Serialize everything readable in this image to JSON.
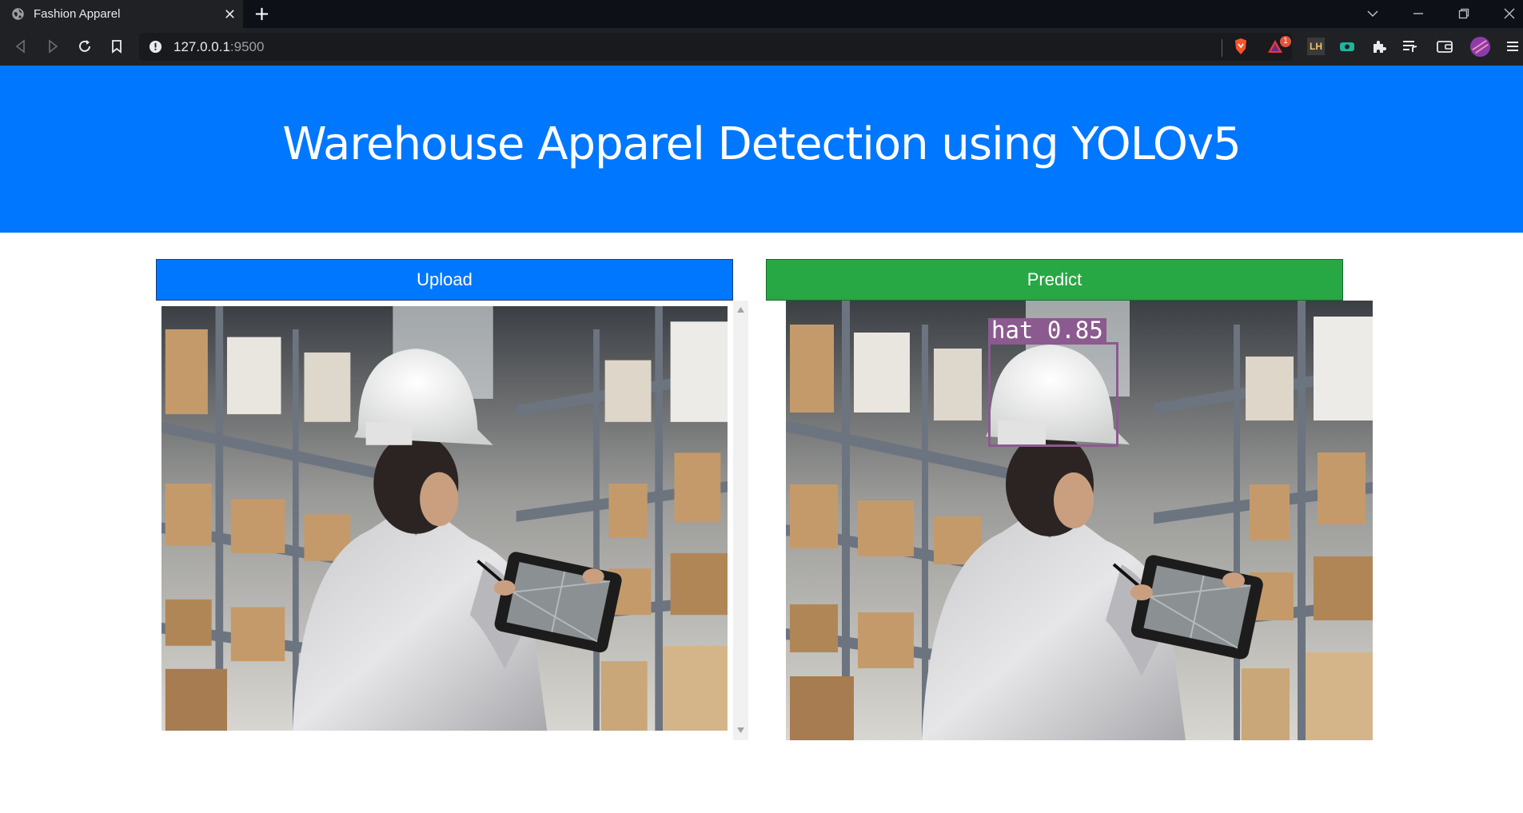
{
  "browser": {
    "tab_title": "Fashion Apparel",
    "url_host": "127.0.0.1",
    "url_port": ":9500",
    "notification_count": "1",
    "ext_lh_label": "LH"
  },
  "page": {
    "title": "Warehouse Apparel Detection using YOLOv5",
    "upload_label": "Upload",
    "predict_label": "Predict"
  },
  "detection": {
    "label": "hat  0.85",
    "color": "#8b5a8f"
  },
  "colors": {
    "hero": "#0077ff",
    "upload": "#0077ff",
    "predict": "#28a745"
  }
}
